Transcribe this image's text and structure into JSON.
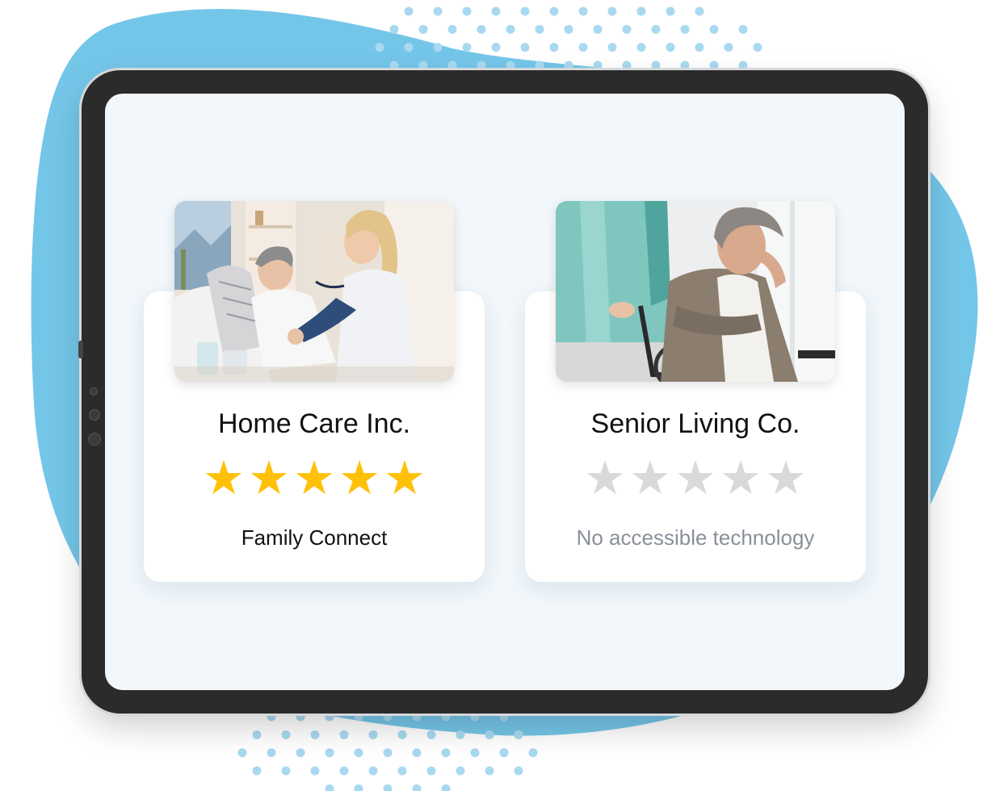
{
  "colors": {
    "blob": "#74c6e8",
    "dots": "#a9d9f0",
    "screen_bg": "#f1f7fb",
    "bezel": "#2b2b2b",
    "star_filled": "#ffc107",
    "star_empty": "#d9d9d9",
    "muted_text": "#8a9099"
  },
  "cards": [
    {
      "title": "Home Care Inc.",
      "rating": 5,
      "rating_max": 5,
      "subtitle": "Family Connect",
      "photo_icon": "caregiver-with-elderly-woman-photo",
      "stars": [
        "★",
        "★",
        "★",
        "★",
        "★"
      ]
    },
    {
      "title": "Senior Living Co.",
      "rating": 0,
      "rating_max": 5,
      "subtitle": "No accessible technology",
      "photo_icon": "elderly-woman-in-wheelchair-photo",
      "stars": [
        "★",
        "★",
        "★",
        "★",
        "★"
      ]
    }
  ]
}
